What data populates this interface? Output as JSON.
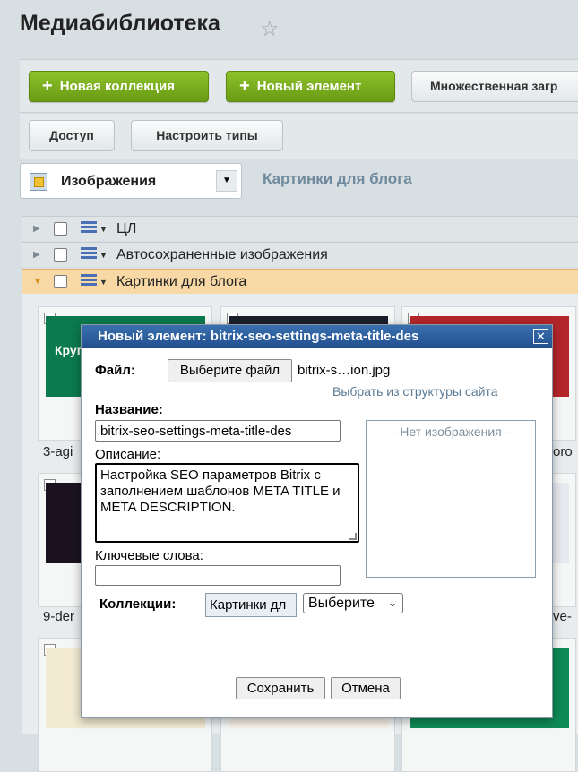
{
  "header": {
    "title": "Медиабиблиотека"
  },
  "toolbar": {
    "new_collection": "Новая коллекция",
    "new_element": "Новый элемент",
    "multi_upload": "Множественная загр",
    "access": "Доступ",
    "configure_types": "Настроить типы"
  },
  "type_selector": {
    "value": "Изображения"
  },
  "collection_heading": "Картинки для блога",
  "tree": [
    {
      "label": "ЦЛ"
    },
    {
      "label": "Автосохраненные изображения"
    },
    {
      "label": "Картинки для блога"
    }
  ],
  "tiles": {
    "name_1": "3-agi",
    "name_2": "oro",
    "name_3": "9-der",
    "name_4": "ve-",
    "t1_text": "Крупне digital"
  },
  "dialog": {
    "title": "Новый элемент: bitrix-seo-settings-meta-title-des",
    "file_label": "Файл:",
    "choose_file": "Выберите файл",
    "file_name": "bitrix-s…ion.jpg",
    "site_link": "Выбрать из структуры сайта",
    "name_label": "Название:",
    "name_value": "bitrix-seo-settings-meta-title-des",
    "no_image": "- Нет изображения -",
    "desc_label": "Описание:",
    "desc_value": "Настройка SEO параметров Bitrix с заполнением шаблонов META TITLE и META DESCRIPTION.",
    "keywords_label": "Ключевые слова:",
    "keywords_value": "",
    "collections_label": "Коллекции:",
    "collection_tag": "Картинки дл",
    "collection_select": "Выберите",
    "save": "Сохранить",
    "cancel": "Отмена"
  }
}
